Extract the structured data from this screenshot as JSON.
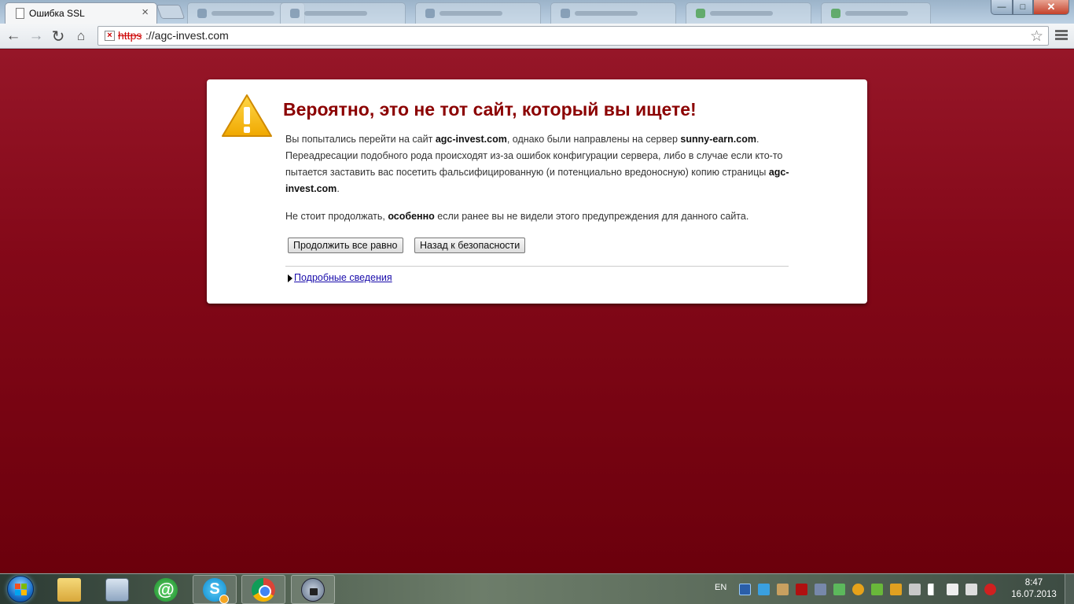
{
  "tabs": {
    "active_title": "Ошибка SSL",
    "close_glyph": "×"
  },
  "window_controls": {
    "minimize": "—",
    "maximize": "□",
    "close": "✕"
  },
  "toolbar": {
    "back": "←",
    "forward": "→",
    "reload": "↻",
    "home": "⌂",
    "url_scheme": "https",
    "url_rest": "://agc-invest.com",
    "ssl_error_glyph": "×",
    "star": "☆"
  },
  "error": {
    "title": "Вероятно, это не тот сайт, который вы ищете!",
    "msg_1": "Вы попытались перейти на сайт ",
    "requested_site": "agc-invest.com",
    "msg_2": ", однако были направлены на сервер ",
    "actual_server": "sunny-earn.com",
    "msg_3": ". Переадресации подобного рода происходят из-за ошибок конфигурации сервера, либо в случае если кто-то пытается заставить вас посетить фальсифицированную (и потенциально вредоносную) копию страницы ",
    "requested_site_2": "agc-invest.com",
    "msg_4": ".",
    "advice_1": "Не стоит продолжать, ",
    "advice_bold": "особенно",
    "advice_2": " если ранее вы не видели этого предупреждения для данного сайта.",
    "proceed_label": "Продолжить все равно",
    "back_label": "Назад к безопасности",
    "details_label": "Подробные сведения"
  },
  "taskbar": {
    "skype_glyph": "S",
    "agent_glyph": "@"
  },
  "tray": {
    "language": "EN",
    "time": "8:47",
    "date": "16.07.2013"
  },
  "colors": {
    "page_background": "#830818",
    "title_color": "#8b0000",
    "link_color": "#1a0dab"
  }
}
